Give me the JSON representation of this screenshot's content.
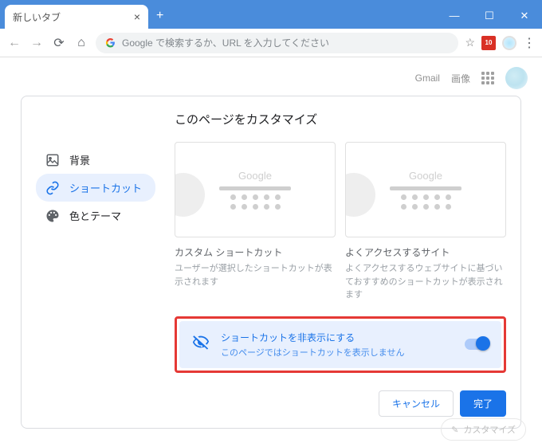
{
  "titlebar": {
    "tab_label": "新しいタブ"
  },
  "omnibox": {
    "placeholder": "Google で検索するか、URL を入力してください"
  },
  "ext_badge": "10",
  "topright": {
    "gmail": "Gmail",
    "images": "画像"
  },
  "dialog": {
    "title": "このページをカスタマイズ",
    "sidebar": {
      "background": "背景",
      "shortcuts": "ショートカット",
      "theme": "色とテーマ"
    },
    "card_preview_label": "Google",
    "card1": {
      "title": "カスタム ショートカット",
      "desc": "ユーザーが選択したショートカットが表示されます"
    },
    "card2": {
      "title": "よくアクセスするサイト",
      "desc": "よくアクセスするウェブサイトに基づいておすすめのショートカットが表示されます"
    },
    "hide": {
      "title": "ショートカットを非表示にする",
      "sub": "このページではショートカットを表示しません"
    },
    "actions": {
      "cancel": "キャンセル",
      "done": "完了"
    }
  },
  "fab": "カスタマイズ"
}
